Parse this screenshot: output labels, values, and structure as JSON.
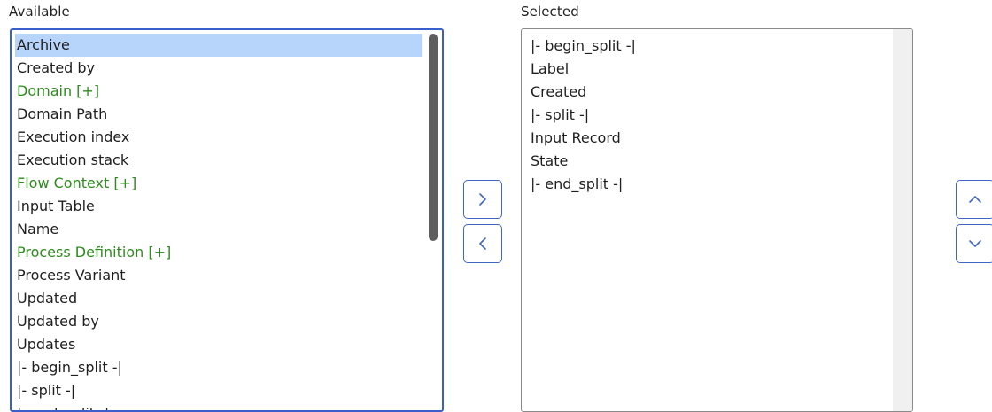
{
  "available": {
    "heading": "Available",
    "items": [
      {
        "label": "Archive",
        "type": "field"
      },
      {
        "label": "Created by",
        "type": "field"
      },
      {
        "label": "Domain [+]",
        "type": "expandable"
      },
      {
        "label": "Domain Path",
        "type": "field"
      },
      {
        "label": "Execution index",
        "type": "field"
      },
      {
        "label": "Execution stack",
        "type": "field"
      },
      {
        "label": "Flow Context [+]",
        "type": "expandable"
      },
      {
        "label": "Input Table",
        "type": "field"
      },
      {
        "label": "Name",
        "type": "field"
      },
      {
        "label": "Process Definition [+]",
        "type": "expandable"
      },
      {
        "label": "Process Variant",
        "type": "field"
      },
      {
        "label": "Updated",
        "type": "field"
      },
      {
        "label": "Updated by",
        "type": "field"
      },
      {
        "label": "Updates",
        "type": "field"
      },
      {
        "label": "|- begin_split -|",
        "type": "field"
      },
      {
        "label": "|- split -|",
        "type": "field"
      },
      {
        "label": "|- end_split -|",
        "type": "field"
      }
    ],
    "highlighted_index": 0
  },
  "selected": {
    "heading": "Selected",
    "items": [
      {
        "label": "|- begin_split -|"
      },
      {
        "label": "Label"
      },
      {
        "label": "Created"
      },
      {
        "label": "|- split -|"
      },
      {
        "label": "Input Record"
      },
      {
        "label": "State"
      },
      {
        "label": "|- end_split -|"
      }
    ]
  },
  "buttons": {
    "add_icon": "chevron-right-icon",
    "remove_icon": "chevron-left-icon",
    "move_up_icon": "chevron-up-icon",
    "move_down_icon": "chevron-down-icon"
  },
  "colors": {
    "focus_border": "#3a5fcd",
    "highlight": "#b7d4fb",
    "expandable_text": "#2e8b1e",
    "button_border": "#3f66c4"
  }
}
